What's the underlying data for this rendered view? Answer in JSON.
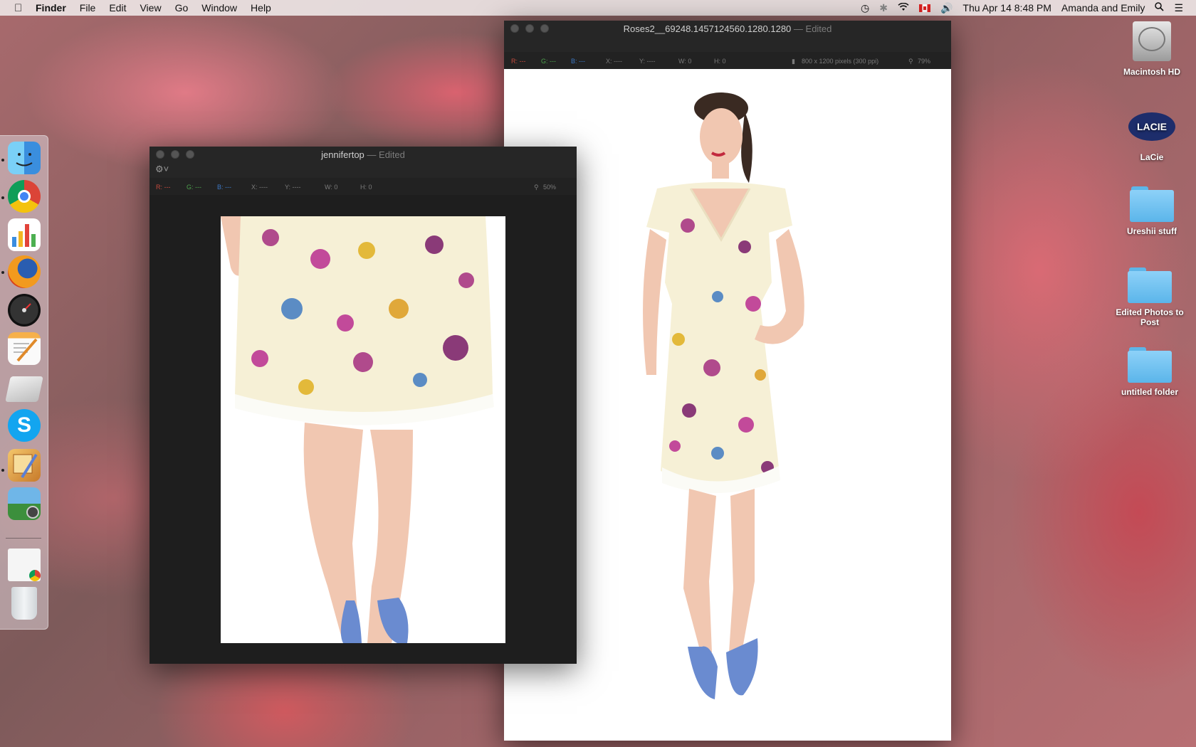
{
  "menubar": {
    "app_name": "Finder",
    "items": [
      "File",
      "Edit",
      "View",
      "Go",
      "Window",
      "Help"
    ],
    "clock": "Thu Apr 14  8:48 PM",
    "user": "Amanda and Emily"
  },
  "dock": {
    "apps": [
      "Finder",
      "Google Chrome",
      "Numbers",
      "Firefox",
      "Dashboard",
      "Pages",
      "Drive",
      "Skype",
      "Preview",
      "iPhoto",
      "Chrome Document",
      "Trash"
    ]
  },
  "window_left": {
    "title": "jennifertop",
    "edited": "— Edited",
    "info": {
      "r": "R: ---",
      "g": "G: ---",
      "b": "B: ---",
      "x": "X: ----",
      "y": "Y: ----",
      "w": "W: 0",
      "h": "H: 0",
      "zoom": "50%"
    }
  },
  "window_right": {
    "title": "Roses2__69248.1457124560.1280.1280",
    "edited": "— Edited",
    "info": {
      "r": "R: ---",
      "g": "G: ---",
      "b": "B: ---",
      "x": "X: ----",
      "y": "Y: ----",
      "w": "W: 0",
      "h": "H: 0",
      "size": "800 x 1200 pixels (300 ppi)",
      "zoom": "79%"
    }
  },
  "desktop_icons": [
    "Macintosh HD",
    "LaCie",
    "Ureshii stuff",
    "Edited Photos to Post",
    "untitled folder"
  ],
  "lacie_logo_text": "LACIE"
}
